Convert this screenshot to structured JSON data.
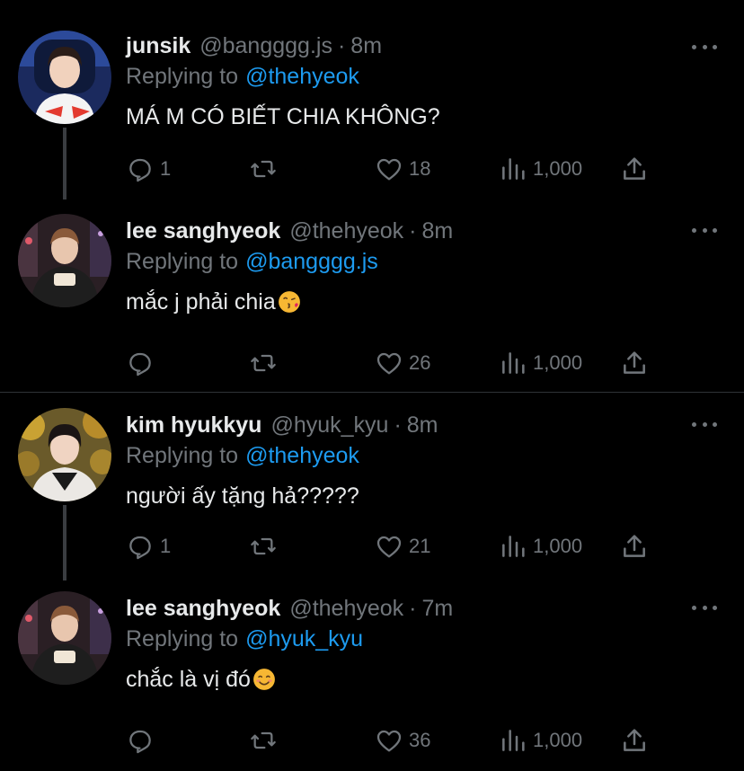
{
  "tweets": [
    {
      "name": "junsik",
      "handle": "@bangggg.js",
      "separator": "·",
      "time": "8m",
      "replying_prefix": "Replying to",
      "replying_to": "@thehyeok",
      "text": "MÁ M CÓ BIẾT CHIA KHÔNG?",
      "emoji": "",
      "replies": "1",
      "likes": "18",
      "views": "1,000"
    },
    {
      "name": "lee sanghyeok",
      "handle": "@thehyeok",
      "separator": "·",
      "time": "8m",
      "replying_prefix": "Replying to",
      "replying_to": "@bangggg.js",
      "text": "mắc j phải chia",
      "emoji": "kissing-face-emoji",
      "replies": "",
      "likes": "26",
      "views": "1,000"
    },
    {
      "name": "kim hyukkyu",
      "handle": "@hyuk_kyu",
      "separator": "·",
      "time": "8m",
      "replying_prefix": "Replying to",
      "replying_to": "@thehyeok",
      "text": "người ấy tặng hả?????",
      "emoji": "",
      "replies": "1",
      "likes": "21",
      "views": "1,000"
    },
    {
      "name": "lee sanghyeok",
      "handle": "@thehyeok",
      "separator": "·",
      "time": "7m",
      "replying_prefix": "Replying to",
      "replying_to": "@hyuk_kyu",
      "text": "chắc là vị đó",
      "emoji": "smiling-face-emoji",
      "replies": "",
      "likes": "36",
      "views": "1,000"
    }
  ],
  "icons": {
    "reply": "reply-icon",
    "retweet": "retweet-icon",
    "like": "heart-icon",
    "views": "views-icon",
    "share": "share-icon",
    "more": "more-icon"
  },
  "colors": {
    "background": "#000000",
    "text": "#e7e9ea",
    "muted": "#71767b",
    "link": "#1d9bf0",
    "thread_line": "#3a3d41",
    "divider": "#2f3336"
  }
}
